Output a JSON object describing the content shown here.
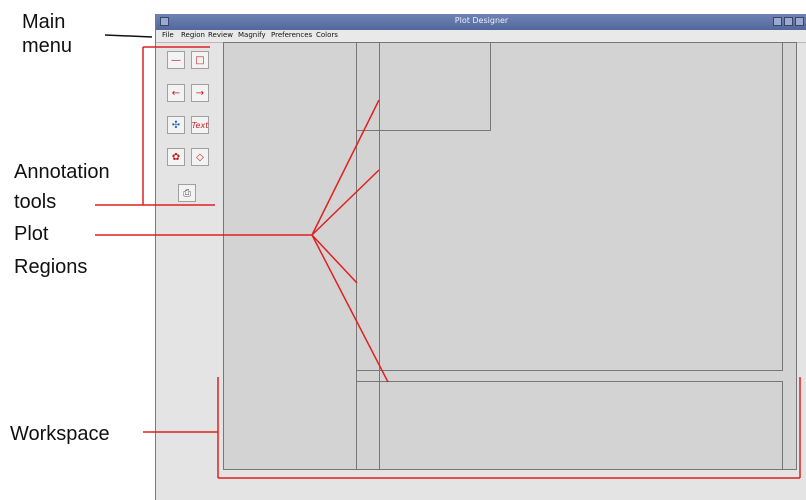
{
  "callouts": {
    "main_menu_line1": "Main",
    "main_menu_line2": "menu",
    "annotation_tools_line1": "Annotation",
    "annotation_tools_line2": "tools",
    "plot_regions_line1": "Plot",
    "plot_regions_line2": "Regions",
    "workspace": "Workspace"
  },
  "window": {
    "title": "Plot Designer"
  },
  "menu": [
    "File",
    "Region",
    "Review",
    "Magnify",
    "Preferences",
    "Colors"
  ],
  "tools": [
    "line-tool-icon",
    "rectangle-tool-icon",
    "arrow-left-icon",
    "arrow-right-icon",
    "color-palette-icon",
    "text-tool-icon",
    "stamp-tool-icon",
    "eraser-tool-icon",
    "print-icon"
  ],
  "colors": {
    "leader_red": "#e02020",
    "leader_black": "#111111",
    "region_fill": "#d3d3d3",
    "titlebar": "#5c72a8"
  }
}
